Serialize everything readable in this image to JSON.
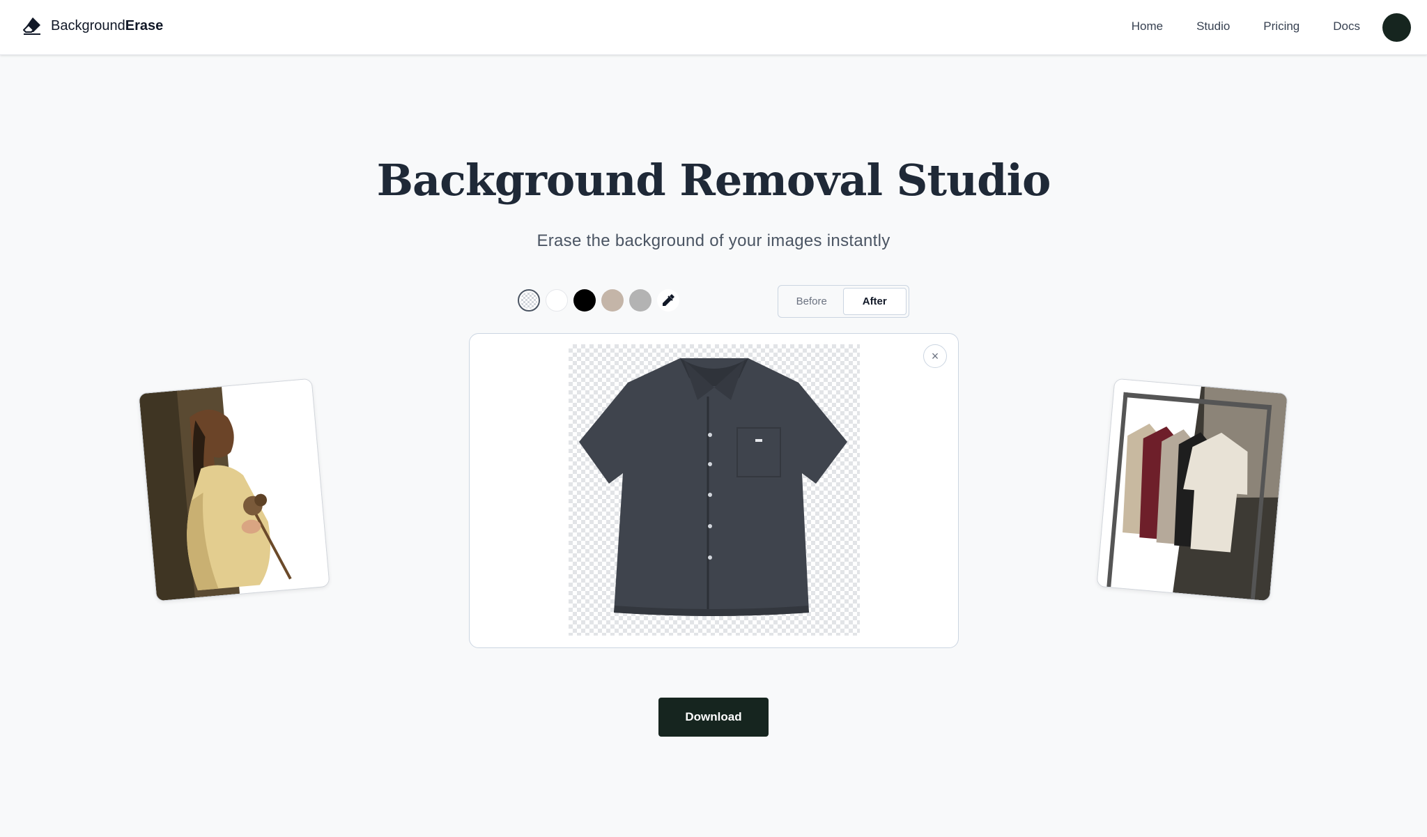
{
  "app": {
    "brand_regular": "Background",
    "brand_bold": "Erase",
    "logo_icon": "eraser-icon"
  },
  "nav": {
    "items": [
      {
        "label": "Home"
      },
      {
        "label": "Studio"
      },
      {
        "label": "Pricing"
      },
      {
        "label": "Docs"
      }
    ],
    "avatar_color": "#16251f"
  },
  "hero": {
    "title": "Background Removal Studio",
    "subtitle": "Erase the background of your images instantly"
  },
  "background_options": [
    {
      "name": "transparent",
      "color": "checkerboard",
      "selected": true
    },
    {
      "name": "white",
      "color": "#ffffff"
    },
    {
      "name": "black",
      "color": "#000000"
    },
    {
      "name": "beige",
      "color": "#c4b5a8"
    },
    {
      "name": "gray",
      "color": "#b3b3b3"
    },
    {
      "name": "color-picker",
      "icon": "eyedropper-icon"
    }
  ],
  "view_toggle": {
    "before_label": "Before",
    "after_label": "After",
    "active": "After"
  },
  "editor": {
    "close_label": "×",
    "result_image": "charcoal button-up shirt with background removed"
  },
  "samples": [
    {
      "description": "woman in cream jacket holding dried flowers"
    },
    {
      "description": "clothing rack with t-shirts on hangers"
    }
  ],
  "actions": {
    "download_label": "Download"
  },
  "colors": {
    "accent": "#16251f",
    "page_bg": "#f8f9fa"
  }
}
